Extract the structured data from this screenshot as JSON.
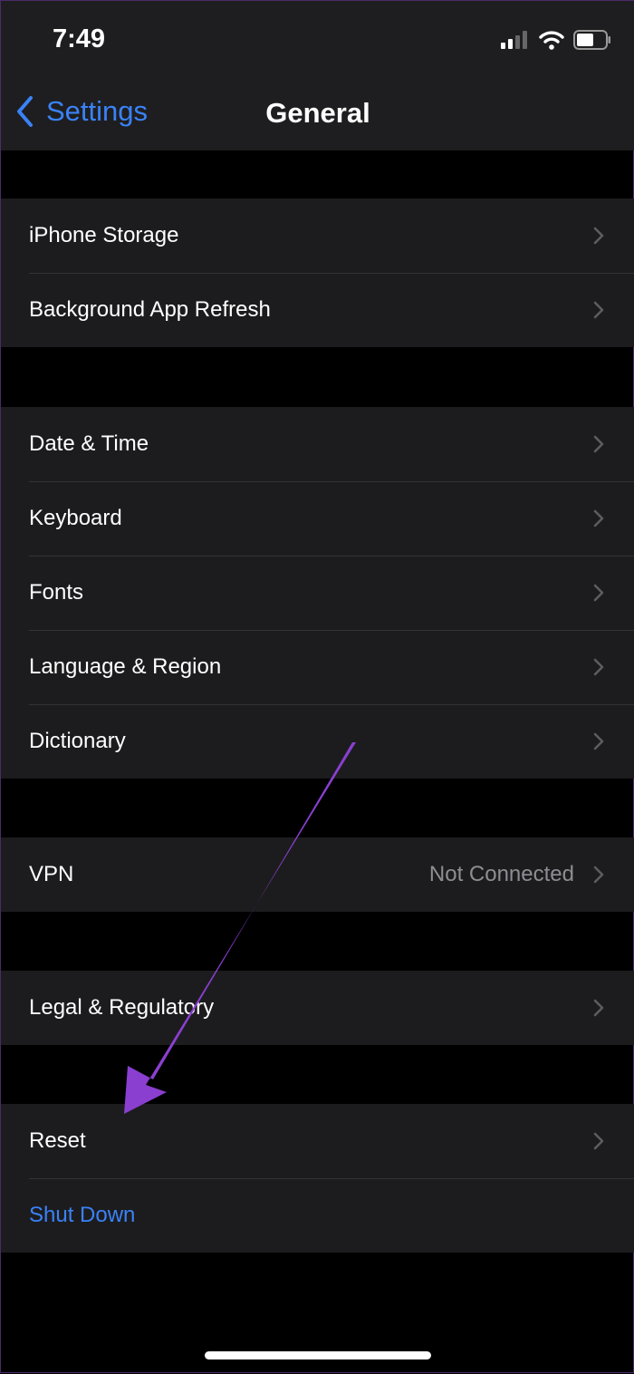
{
  "status_bar": {
    "time": "7:49",
    "icons": [
      "cellular-signal-icon",
      "wifi-icon",
      "battery-icon"
    ]
  },
  "nav": {
    "back_label": "Settings",
    "title": "General"
  },
  "groups": [
    [
      {
        "label": "iPhone Storage"
      },
      {
        "label": "Background App Refresh"
      }
    ],
    [
      {
        "label": "Date & Time"
      },
      {
        "label": "Keyboard"
      },
      {
        "label": "Fonts"
      },
      {
        "label": "Language & Region"
      },
      {
        "label": "Dictionary"
      }
    ],
    [
      {
        "label": "VPN",
        "value": "Not Connected"
      }
    ],
    [
      {
        "label": "Legal & Regulatory"
      }
    ],
    [
      {
        "label": "Reset"
      },
      {
        "label": "Shut Down"
      }
    ]
  ],
  "annotation": {
    "type": "arrow",
    "color": "#8a3fd0",
    "points_to": "Reset"
  },
  "colors": {
    "accent": "#3a82f7",
    "background": "#000000",
    "cell": "#1c1c1e"
  }
}
